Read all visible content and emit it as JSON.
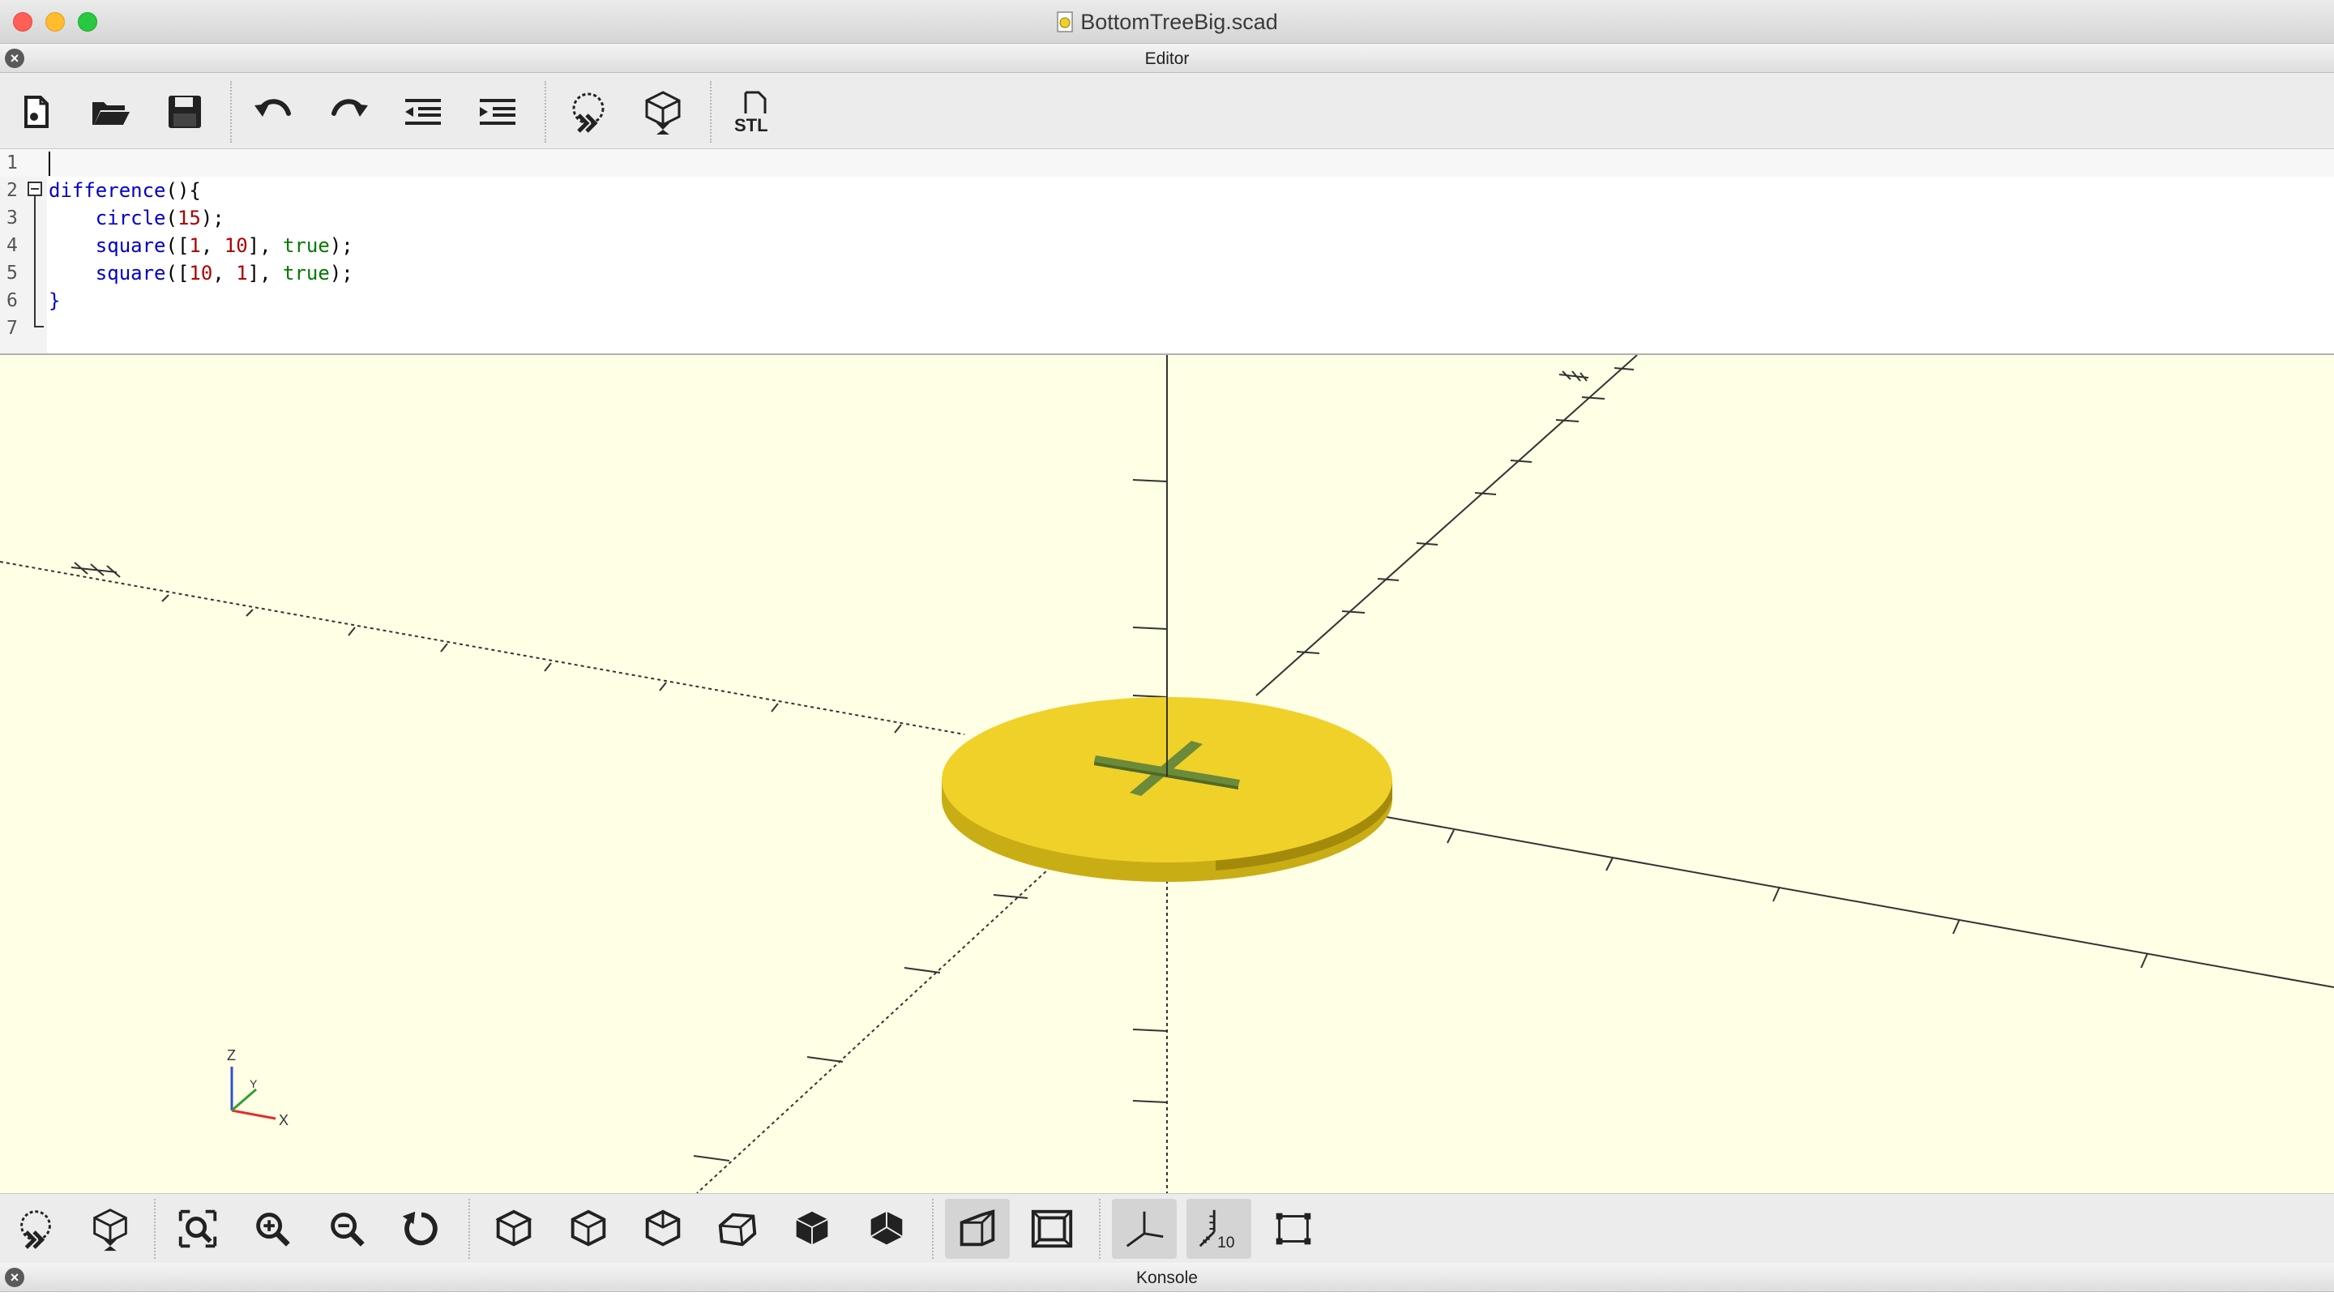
{
  "window": {
    "title": "BottomTreeBig.scad"
  },
  "editor_dock": {
    "title": "Editor",
    "close_label": "×"
  },
  "editor_toolbar": {
    "buttons": [
      {
        "name": "new-file",
        "icon": "new-document-icon"
      },
      {
        "name": "open-file",
        "icon": "folder-open-icon"
      },
      {
        "name": "save-file",
        "icon": "floppy-disk-icon"
      },
      {
        "name": "undo",
        "icon": "undo-icon"
      },
      {
        "name": "redo",
        "icon": "redo-icon"
      },
      {
        "name": "unindent",
        "icon": "unindent-icon"
      },
      {
        "name": "indent",
        "icon": "indent-icon"
      },
      {
        "name": "preview",
        "icon": "preview-icon"
      },
      {
        "name": "render",
        "icon": "render-icon"
      },
      {
        "name": "export-stl",
        "icon": "stl-export-icon",
        "label": "STL"
      }
    ]
  },
  "code_editor": {
    "lines": [
      {
        "n": "1",
        "text": ""
      },
      {
        "n": "2",
        "text": "difference(){"
      },
      {
        "n": "3",
        "text": "    circle(15);"
      },
      {
        "n": "4",
        "text": "    square([1, 10], true);"
      },
      {
        "n": "5",
        "text": "    square([10, 1], true);"
      },
      {
        "n": "6",
        "text": "}"
      },
      {
        "n": "7",
        "text": ""
      }
    ]
  },
  "viewport": {
    "axis_indicator": {
      "z_label": "Z",
      "x_label": "X",
      "y_label": "Y"
    },
    "colors": {
      "background": "#ffffe5",
      "model": "#f0d12a",
      "model_side": "#c9ad15",
      "cut": "#6b8a3a"
    }
  },
  "view_toolbar": {
    "buttons": [
      {
        "name": "preview",
        "icon": "preview-icon"
      },
      {
        "name": "render",
        "icon": "render-icon"
      },
      {
        "name": "view-all",
        "icon": "zoom-fit-icon"
      },
      {
        "name": "zoom-in",
        "icon": "zoom-in-icon"
      },
      {
        "name": "zoom-out",
        "icon": "zoom-out-icon"
      },
      {
        "name": "reset-view",
        "icon": "reset-view-icon"
      },
      {
        "name": "view-right",
        "icon": "cube-right-icon"
      },
      {
        "name": "view-top",
        "icon": "cube-top-icon"
      },
      {
        "name": "view-bottom",
        "icon": "cube-bottom-icon"
      },
      {
        "name": "view-left",
        "icon": "cube-left-icon"
      },
      {
        "name": "view-front",
        "icon": "cube-front-icon"
      },
      {
        "name": "view-back",
        "icon": "cube-back-icon"
      },
      {
        "name": "perspective",
        "icon": "perspective-icon"
      },
      {
        "name": "orthogonal",
        "icon": "orthogonal-icon"
      },
      {
        "name": "show-axes",
        "icon": "axes-icon"
      },
      {
        "name": "show-scale",
        "icon": "scale-markers-icon",
        "label": "10"
      },
      {
        "name": "show-edges",
        "icon": "edges-icon"
      }
    ]
  },
  "console_dock": {
    "title": "Konsole",
    "close_label": "×"
  }
}
